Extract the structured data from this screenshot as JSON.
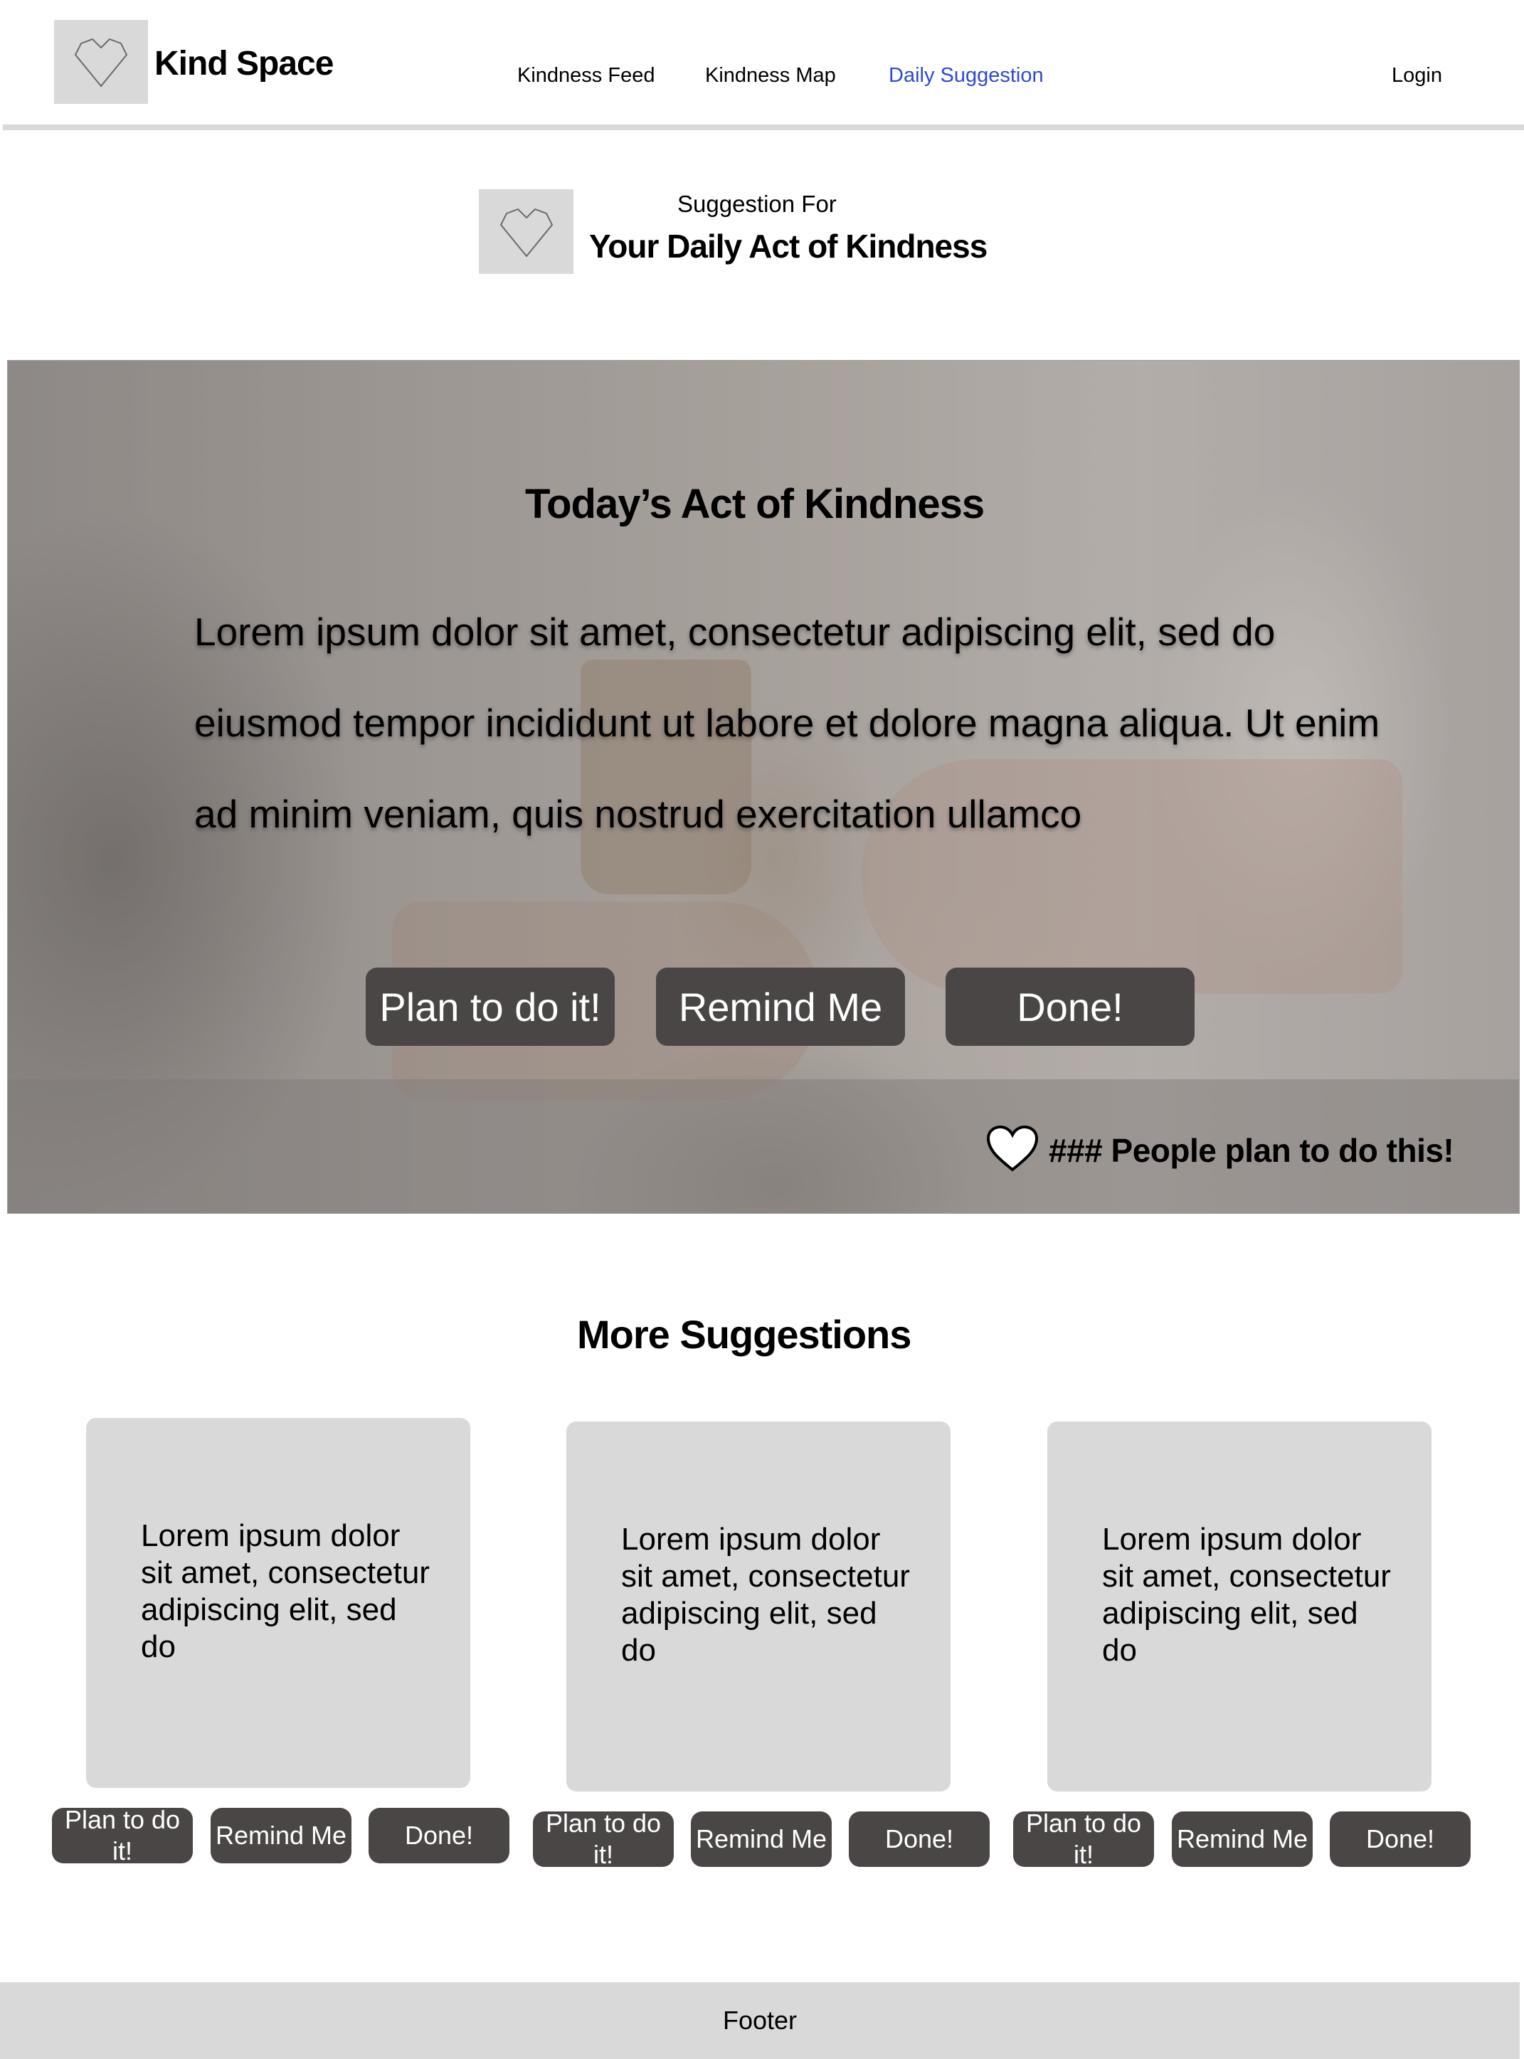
{
  "header": {
    "brand": "Kind Space",
    "logo_icon": "heart-outline-icon",
    "nav": {
      "feed": "Kindness Feed",
      "map": "Kindness Map",
      "daily": "Daily Suggestion",
      "login": "Login"
    },
    "active_nav_color": "#2f49d1"
  },
  "suggestion_header": {
    "label": "Suggestion For",
    "title": "Your Daily Act of Kindness",
    "icon": "heart-outline-icon"
  },
  "hero": {
    "title": "Today’s Act of Kindness",
    "body": "Lorem ipsum dolor sit amet, consectetur adipiscing elit, sed do eiusmod tempor incididunt ut labore et dolore magna aliqua. Ut enim ad minim veniam, quis nostrud exercitation ullamco",
    "buttons": {
      "plan": "Plan to do it!",
      "remind": "Remind Me",
      "done": "Done!"
    },
    "count_icon": "heart-icon",
    "count_text": "### People plan to do this!"
  },
  "more": {
    "title": "More Suggestions",
    "cards": [
      {
        "text": "Lorem ipsum dolor sit amet, consectetur adipiscing elit, sed do",
        "plan": "Plan to do it!",
        "remind": "Remind Me",
        "done": "Done!"
      },
      {
        "text": "Lorem ipsum dolor sit amet, consectetur adipiscing elit, sed do",
        "plan": "Plan to do it!",
        "remind": "Remind Me",
        "done": "Done!"
      },
      {
        "text": "Lorem ipsum dolor sit amet, consectetur adipiscing elit, sed do",
        "plan": "Plan to do it!",
        "remind": "Remind Me",
        "done": "Done!"
      }
    ]
  },
  "footer": {
    "label": "Footer"
  },
  "colors": {
    "button_bg": "#4a4646",
    "placeholder_gray": "#d9d9d9"
  }
}
